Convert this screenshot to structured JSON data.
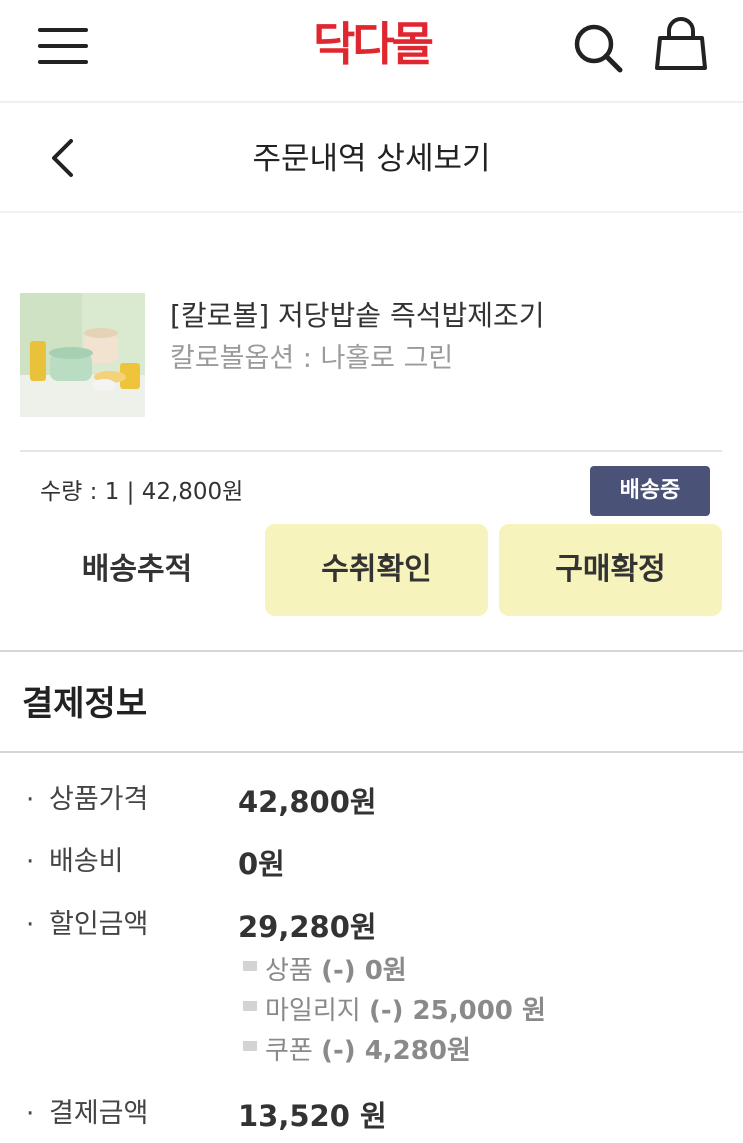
{
  "header": {
    "logo": "닥다몰",
    "icons": {
      "menu": "menu-icon",
      "search": "search-icon",
      "cart": "shopping-bag-icon"
    },
    "brand_color": "#e0262e"
  },
  "subheader": {
    "title": "주문내역 상세보기",
    "back_icon": "chevron-left-icon"
  },
  "order_item": {
    "name": "[칼로볼] 저당밥솥 즉석밥제조기",
    "option": "칼로볼옵션 : 나홀로 그린",
    "quantity_price": "수량 : 1 | 42,800원",
    "status": "배송중",
    "status_color": "#4a5278"
  },
  "actions": {
    "track": "배송추적",
    "receipt": "수취확인",
    "confirm": "구매확정",
    "highlight_color": "#f7f3bc"
  },
  "payment": {
    "title": "결제정보",
    "bullet": "·",
    "rows": [
      {
        "label": "상품가격",
        "value": "42,800원"
      },
      {
        "label": "배송비",
        "value": "0원"
      },
      {
        "label": "할인금액",
        "value": "29,280원"
      },
      {
        "label": "결제금액",
        "value": "13,520 원"
      }
    ],
    "discount_details": [
      {
        "label": "상품",
        "amount": "(-) 0원"
      },
      {
        "label": "마일리지",
        "amount": "(-) 25,000 원"
      },
      {
        "label": "쿠폰",
        "amount": "(-) 4,280원"
      }
    ]
  }
}
